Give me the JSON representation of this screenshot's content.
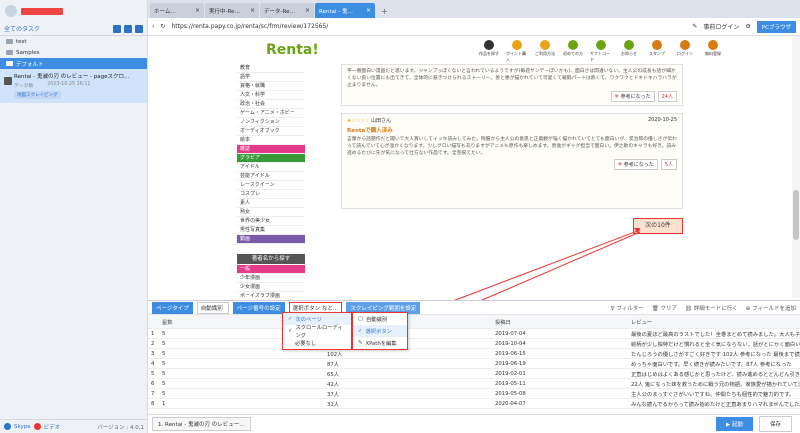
{
  "sidebar": {
    "all_tasks": "全てのタスク",
    "tree": [
      {
        "label": "test"
      },
      {
        "label": "Samples"
      },
      {
        "label": "デフォルト"
      }
    ],
    "task": {
      "title": "Rentai - 鬼滅の刃 のレビュー - pageスクロ…",
      "date_label": "データ数",
      "date": "2023-10-25 16:11",
      "badge": "地図スクレイピング"
    },
    "footer": {
      "skype": "Skype",
      "video": "ビデオ",
      "version": "バージョン : 4.0.1"
    }
  },
  "browser": {
    "tabs": [
      "ホーム…",
      "実行中-Re…",
      "データ-Re…",
      "Rentai - 鬼…"
    ],
    "url": "https://renta.papy.co.jp/renta/sc/frm/review/172565/",
    "login": "事前ログイン",
    "pc_browser": "PCブラウザ"
  },
  "site": {
    "logo": "Renta!",
    "nav": [
      "作品を探す",
      "ポイント購入",
      "ご利用方法",
      "初めての方",
      "ギフトコード",
      "お知らせ",
      "スタンプ",
      "ログイン",
      "無料登録"
    ],
    "nav_colors": [
      "#333",
      "#e8a317",
      "#e8a317",
      "#6aa414",
      "#6aa414",
      "#6aa414",
      "#d87a12",
      "#d87a12",
      "#d87a12"
    ],
    "categories": [
      "教育",
      "語学",
      "資格・就職",
      "人文・科学",
      "政治・社会",
      "ゲーム・アニメ・ホビー",
      "ノンフィクション",
      "オーディオブック",
      "絵本"
    ],
    "cat_mag": "雑誌",
    "cat_grav": "グラビア",
    "cats_more": [
      "アイドル",
      "芸能アイドル",
      "レースクイーン",
      "コスプレ",
      "素人",
      "熟女",
      "世界の美少女",
      "男性写真集"
    ],
    "cat_video": "動画",
    "author_section": "著者名から探す",
    "cats2": [
      "一般",
      "少年漫画",
      "少女漫画",
      "ボーイズラブ漫画"
    ],
    "review1": {
      "text": "平一番面白い漫画だと思います。ジャンプっぽくないと言われているようですが(毎週サンデーぽいかも)、面白さは間違いない。主人公の成長も話が細かくない良い位置にも出てきて、全体的に惹きつけられるストーリー。善と悪が描かれていて可愛くて戦闘パートは熱くて、ワクワクとドキドキハラハラが止まりません。",
      "like": "参考になった",
      "count": "24人"
    },
    "review2": {
      "stars": "★☆☆☆☆",
      "user": "山田さん",
      "date": "2020-10-25",
      "title": "Rentaで購入済み",
      "text": "言葉から話題作だと聞いて大人買いしてイッキ読みしてみた。残酷から主人公の意思と正義観が強く描かれていてとても面白いが、炭治郎の優しさが伝わって読んでいて心が温かくなります。少しグロい描写もありますがアニメも原作も楽しめます。善逸がギャグ担当で面白い。伊之助のキャラも好き。読み進めるたびに先が気になって仕方ない作品です。全巻揃えたい。",
      "like": "参考になった",
      "count": "5人"
    },
    "next_btn": "次の10件"
  },
  "bottom": {
    "toolbar": {
      "page_type_label": "ページタイプ",
      "page_type": "自動識別",
      "page_setting_label": "ページ番号の設定",
      "page_setting": "選択ボタン なと…",
      "scroll_range_label": "スクレイピング範囲を設定",
      "filter": "フィルター",
      "clear": "クリア",
      "to_edit": "詳細モードに行く",
      "add_field": "フィールドを追加"
    },
    "columns": [
      "",
      "星数",
      "投稿日",
      "レビュー"
    ],
    "rows": [
      {
        "n": "1",
        "stars": "5",
        "likes": "",
        "date": "2019-07-04",
        "review": "最後の夏ほど最高のラストでした！全巻まとめて読みました。大人も子供も楽しめる作品。"
      },
      {
        "n": "2",
        "stars": "5",
        "likes": "",
        "date": "2019-10-04",
        "review": "絵柄が少し独特だけど慣れると全く気にならない。話がとにかく面白いおすすめです。"
      },
      {
        "n": "3",
        "stars": "5",
        "likes": "102人",
        "date": "2019-06-15",
        "review": "たんじろうの優しさがすごく好きです 102人 参考になった 最後まで読みたい作品。"
      },
      {
        "n": "4",
        "stars": "5",
        "likes": "87人",
        "date": "2019-06-19",
        "review": "めっちゃ面白いです。早く続きが読みたいです。87人 参考になった"
      },
      {
        "n": "5",
        "stars": "5",
        "likes": "65人",
        "date": "2019-02-01",
        "review": "正直はじめはよくある感じかと思ったけど、読み進めるとどんどん引き込まれる。"
      },
      {
        "n": "6",
        "stars": "5",
        "likes": "42人",
        "date": "2019-05-11",
        "review": "22人 鬼になった妹を救うために戦う兄の物語。家族愛が描かれていて泣けます。"
      },
      {
        "n": "7",
        "stars": "5",
        "likes": "37人",
        "date": "2019-05-08",
        "review": "主人公のまっすぐさがいいですね。仲間たちも個性的で魅力的です。"
      },
      {
        "n": "8",
        "stars": "1",
        "likes": "31人",
        "date": "2020-04-07",
        "review": "みんな読んでるからって読み始めたけど正直あまりハマれませんでした。"
      }
    ],
    "dropdown1": [
      {
        "label": "次のページ",
        "checked": true
      },
      {
        "label": "スクロールローディング",
        "checked": true
      },
      {
        "label": "必要なし",
        "checked": false
      }
    ],
    "dropdown2": [
      {
        "label": "自動識別"
      },
      {
        "label": "選択ボタン"
      },
      {
        "label": "XPathを編集"
      }
    ]
  },
  "status": {
    "workflow_tab": "1. Rentai - 鬼滅の刃 のレビュー…",
    "run": "起動",
    "save": "保存"
  }
}
